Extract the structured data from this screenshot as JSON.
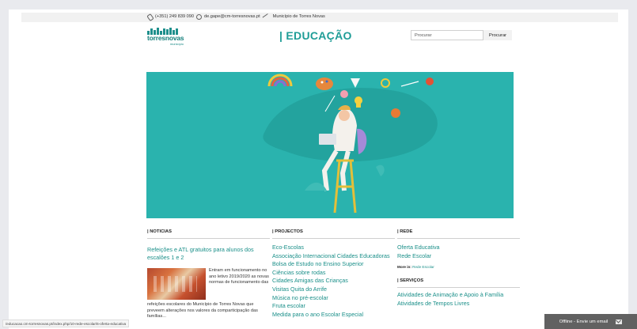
{
  "topbar": {
    "phone": "(+351) 249 839 090",
    "email": "de.gape@cm-torresnovas.pt",
    "municipality": "Município de Torres Novas"
  },
  "header": {
    "logo_word": "torresnovas",
    "logo_sub": "município",
    "site_title": "| EDUCAÇÃO",
    "search_placeholder": "Procurar",
    "search_button": "Procurar"
  },
  "news": {
    "heading": "| NOTICIAS",
    "title": "Refeições e ATL gratuitos para alunos dos escalões 1 e 2",
    "text_right": "Entram em funcionamento no ano letivo 2019/2020 as novas normas de funcionamento das",
    "text_below": "refeições escolares do Município de Torres Novas que preveem alterações nos valores da comparticipação das famílias..."
  },
  "projects": {
    "heading": "| PROJECTOS",
    "items": [
      "Eco-Escolas",
      "Associação Internacional Cidades Educadoras",
      "Bolsa de Estudo no Ensino Superior",
      "Ciências sobre rodas",
      "Cidades Amigas das Crianças",
      "Visitas Quita do Arrife",
      "Música no pré-escolar",
      "Fruta escolar",
      "Medida para o ano Escolar Especial"
    ]
  },
  "network": {
    "heading": "| REDE",
    "items": [
      "Oferta Educativa",
      "Rede Escolar"
    ],
    "more_label": "More in:",
    "more_link": "Rede Escolar"
  },
  "services": {
    "heading": "| SERVIÇOS",
    "items": [
      "Atividades de Animação e Apoio à Família",
      "Atividades de Tempos Livres"
    ]
  },
  "status_url": "/educacao.cm-torresnovas.pt/index.php/10-rede-escolar/6-oferta-educativa",
  "chat": {
    "label": "Offline - Envie um email"
  },
  "colors": {
    "accent": "#1a8f89",
    "hero": "#2ab3ae"
  }
}
